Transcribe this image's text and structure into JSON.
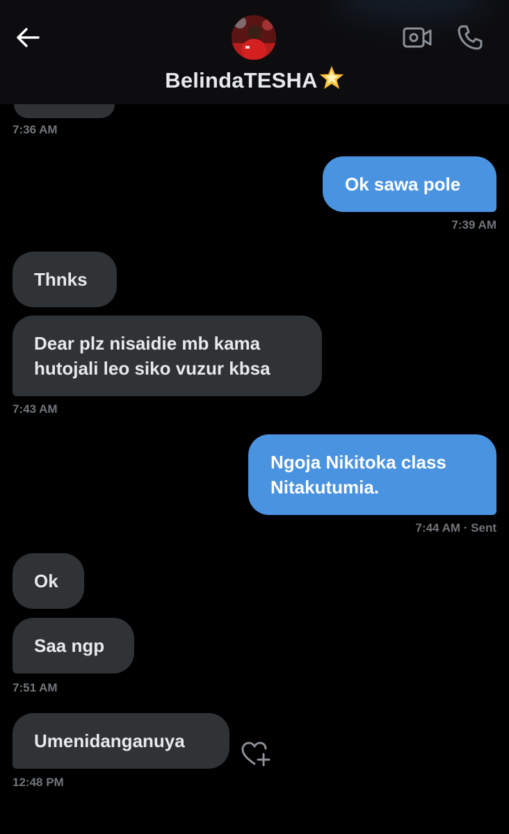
{
  "header": {
    "contact_name": "BelindaTESHA",
    "back_icon": "arrow-left-icon",
    "video_icon": "video-camera-icon",
    "call_icon": "phone-icon",
    "name_emoji_icon": "glowing-star-icon"
  },
  "messages": [
    {
      "id": "m0",
      "direction": "received",
      "text": "",
      "timestamp": "7:36 AM"
    },
    {
      "id": "m1",
      "direction": "sent",
      "text": "Ok sawa pole",
      "timestamp": "7:39 AM"
    },
    {
      "id": "m2",
      "direction": "received",
      "text": "Thnks"
    },
    {
      "id": "m3",
      "direction": "received",
      "lines": [
        "Dear plz nisaidie mb kama",
        "hutojali leo siko vuzur kbsa"
      ],
      "timestamp": "7:43 AM"
    },
    {
      "id": "m4",
      "direction": "sent",
      "lines": [
        "Ngoja Nikitoka class",
        "Nitakutumia."
      ],
      "timestamp": "7:44 AM",
      "status": "Sent"
    },
    {
      "id": "m5",
      "direction": "received",
      "text": "Ok"
    },
    {
      "id": "m6",
      "direction": "received",
      "text": "Saa ngp",
      "timestamp": "7:51 AM"
    },
    {
      "id": "m7",
      "direction": "received",
      "text": "Umenidanganuya",
      "timestamp": "12:48 PM"
    }
  ],
  "timestamps": {
    "t0": "7:36 AM",
    "t1": "7:39 AM",
    "t3": "7:43 AM",
    "t4": "7:44 AM · Sent",
    "t6": "7:51 AM",
    "t7": "12:48 PM"
  },
  "reaction_icon": "heart-plus-icon",
  "colors": {
    "background": "#000000",
    "header_background": "#0d0d10",
    "received_bubble": "#2f3336",
    "sent_bubble": "#4a93e0",
    "text_primary": "#e7e9ea",
    "text_secondary": "#71767b"
  }
}
